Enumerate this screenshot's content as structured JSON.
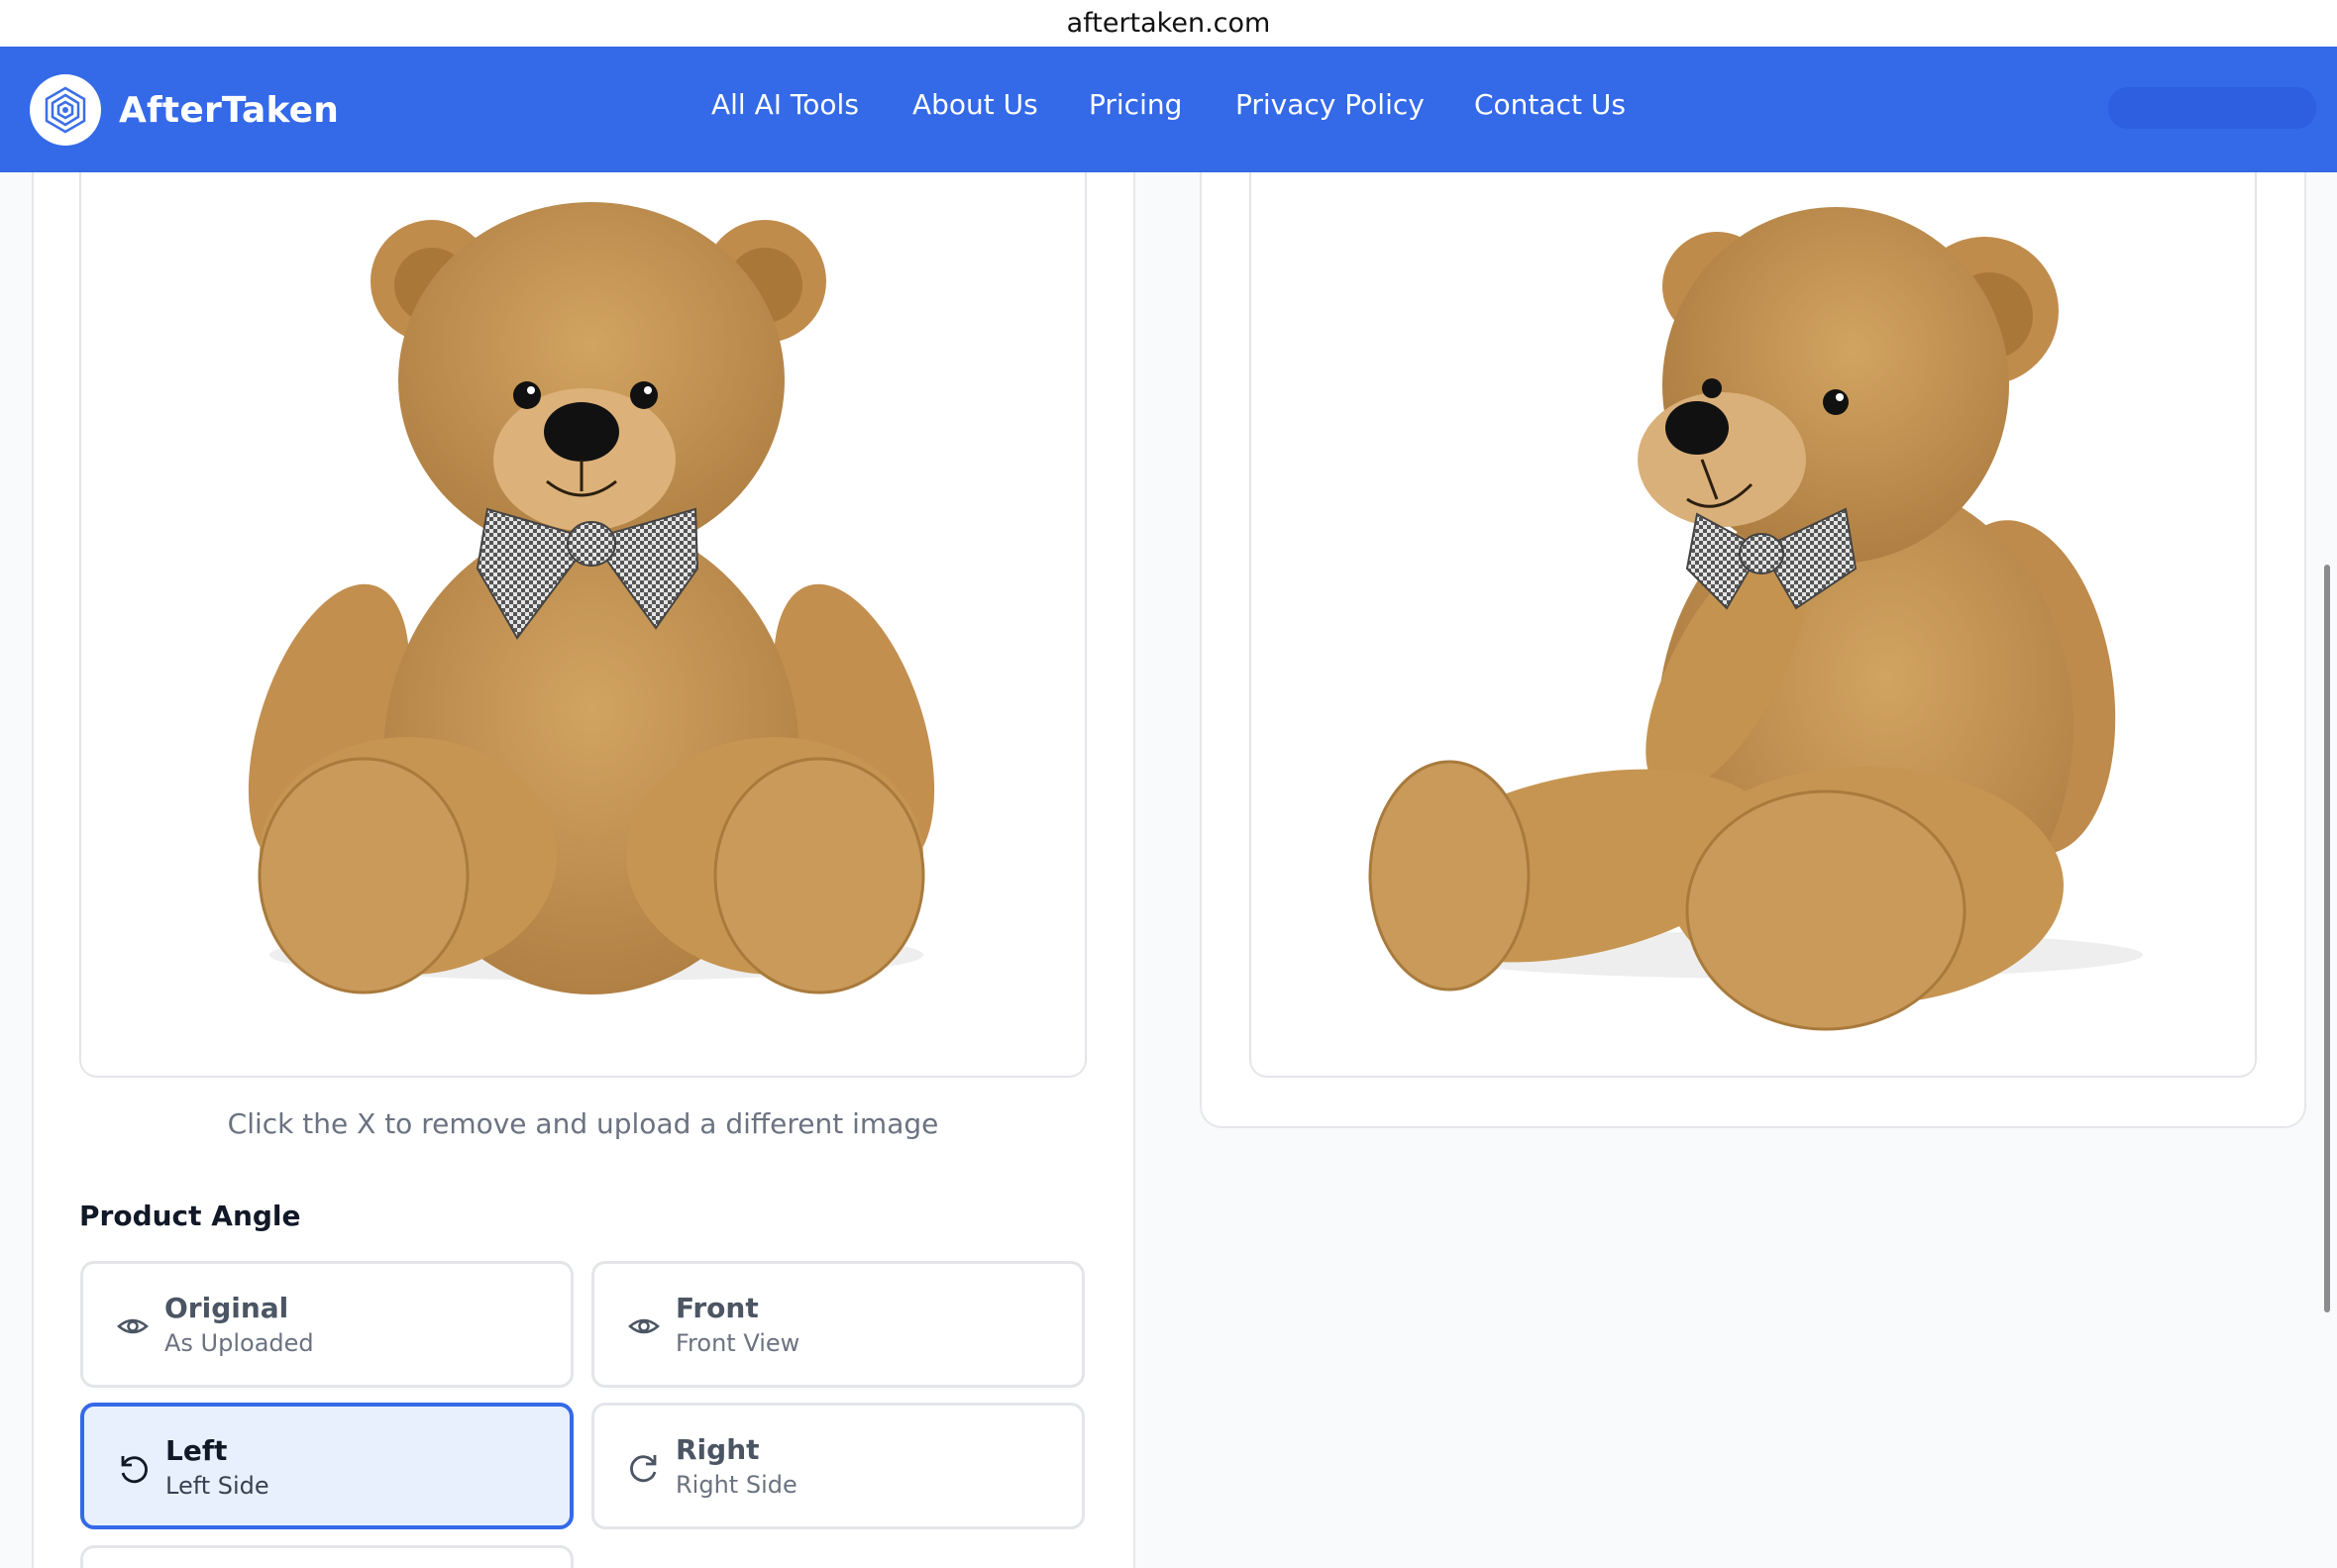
{
  "browser": {
    "url": "aftertaken.com"
  },
  "nav": {
    "brand": "AfterTaken",
    "links": [
      "All AI Tools",
      "About Us",
      "Pricing",
      "Privacy Policy",
      "Contact Us"
    ]
  },
  "upload": {
    "hint": "Click the X to remove and upload a different image"
  },
  "product_angle": {
    "title": "Product Angle",
    "options": [
      {
        "title": "Original",
        "subtitle": "As Uploaded",
        "icon": "eye-icon",
        "selected": false
      },
      {
        "title": "Front",
        "subtitle": "Front View",
        "icon": "eye-icon",
        "selected": false
      },
      {
        "title": "Left",
        "subtitle": "Left Side",
        "icon": "rotate-left-icon",
        "selected": true
      },
      {
        "title": "Right",
        "subtitle": "Right Side",
        "icon": "rotate-right-icon",
        "selected": false
      }
    ]
  },
  "images": {
    "original": "teddy-bear-front",
    "result": "teddy-bear-left-side"
  },
  "colors": {
    "nav": "#3469e8",
    "accent": "#3469e8",
    "selected_bg": "#e8f0fd"
  }
}
